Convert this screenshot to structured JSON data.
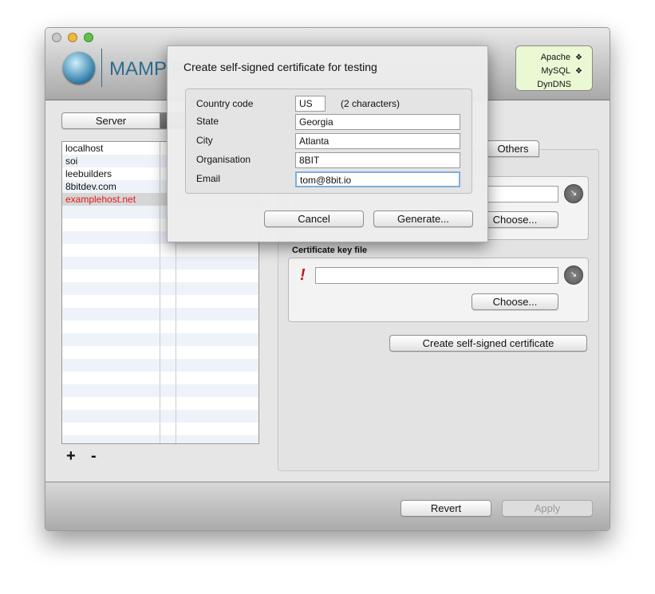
{
  "window": {
    "brand": "MAMP P",
    "status": [
      {
        "label": "Apache",
        "icon": "diamond-icon"
      },
      {
        "label": "MySQL",
        "icon": "diamond-icon"
      },
      {
        "label": "DynDNS"
      }
    ]
  },
  "segments": {
    "server": "Server"
  },
  "hosts": [
    {
      "name": "localhost"
    },
    {
      "name": "soi"
    },
    {
      "name": "leebuilders"
    },
    {
      "name": "8bitdev.com"
    },
    {
      "name": "examplehost.net",
      "color": "#e8141b"
    }
  ],
  "list_buttons": {
    "add": "+",
    "remove": "-"
  },
  "tabs": {
    "others": "Others"
  },
  "cert": {
    "key_label": "Certificate key file",
    "warning": "!",
    "choose": "Choose...",
    "create": "Create self-signed certificate"
  },
  "footer": {
    "revert": "Revert",
    "apply": "Apply"
  },
  "dialog": {
    "title": "Create self-signed certificate for testing",
    "fields": [
      {
        "label": "Country code",
        "value": "US",
        "hint": "(2 characters)"
      },
      {
        "label": "State",
        "value": "Georgia"
      },
      {
        "label": "City",
        "value": "Atlanta"
      },
      {
        "label": "Organisation",
        "value": "8BIT"
      },
      {
        "label": "Email",
        "value": "tom@8bit.io"
      }
    ],
    "cancel": "Cancel",
    "generate": "Generate..."
  }
}
